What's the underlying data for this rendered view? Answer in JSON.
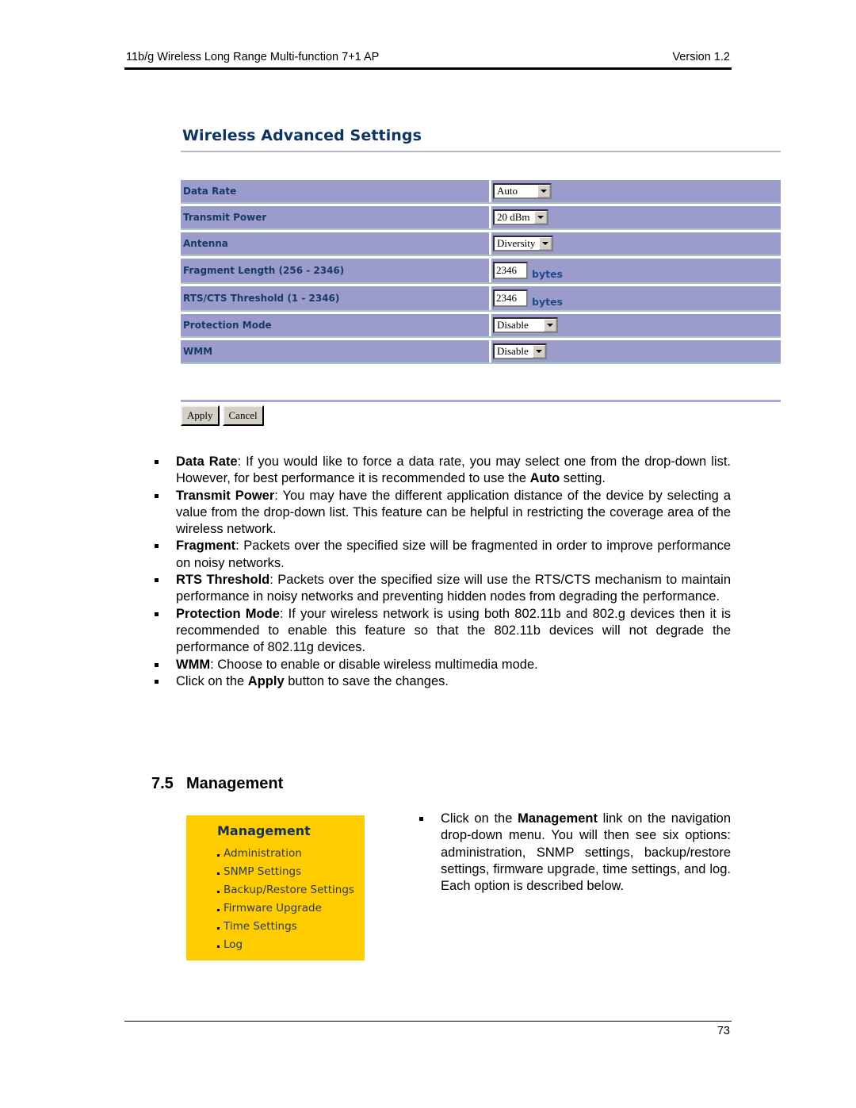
{
  "header": {
    "title": "11b/g Wireless Long Range Multi-function 7+1 AP",
    "version": "Version 1.2"
  },
  "screenshot": {
    "title": "Wireless Advanced Settings",
    "rows": [
      {
        "label": "Data Rate",
        "type": "select",
        "value": "Auto"
      },
      {
        "label": "Transmit Power",
        "type": "select",
        "value": "20 dBm"
      },
      {
        "label": "Antenna",
        "type": "select",
        "value": "Diversity"
      },
      {
        "label": "Fragment Length (256 - 2346)",
        "type": "text",
        "value": "2346",
        "unit": "bytes"
      },
      {
        "label": "RTS/CTS Threshold (1 - 2346)",
        "type": "text",
        "value": "2346",
        "unit": "bytes"
      },
      {
        "label": "Protection Mode",
        "type": "select",
        "value": "Disable"
      },
      {
        "label": "WMM",
        "type": "select",
        "value": "Disable"
      }
    ],
    "apply_label": "Apply",
    "cancel_label": "Cancel"
  },
  "descriptions": [
    {
      "term": "Data Rate",
      "text_before": ": If you would like to force a data rate, you may select one from the drop-down list. However, for best performance it is recommended to use the ",
      "bold_mid": "Auto",
      "text_after": " setting."
    },
    {
      "term": "Transmit Power",
      "text_before": ": You may have the different application distance of the device by selecting a value from the drop-down list. This feature can be helpful in restricting the coverage area of the wireless network.",
      "bold_mid": "",
      "text_after": ""
    },
    {
      "term": "Fragment",
      "text_before": ": Packets over the specified size will be fragmented in order to improve performance on noisy networks.",
      "bold_mid": "",
      "text_after": ""
    },
    {
      "term": "RTS Threshold",
      "text_before": ": Packets over the specified size will use the RTS/CTS mechanism to maintain performance in noisy networks and preventing hidden nodes from degrading the performance.",
      "bold_mid": "",
      "text_after": ""
    },
    {
      "term": "Protection Mode",
      "text_before": ": If your wireless network is using both 802.11b and 802.g devices then it is recommended to enable this feature so that the 802.11b devices will not degrade the performance of 802.11g devices.",
      "bold_mid": "",
      "text_after": ""
    },
    {
      "term": "WMM",
      "text_before": ": Choose to enable or disable wireless multimedia mode.",
      "bold_mid": "",
      "text_after": ""
    },
    {
      "term": "",
      "text_before": "Click on the ",
      "bold_mid": "Apply",
      "text_after": " button to save the changes."
    }
  ],
  "section": {
    "number": "7.5",
    "title": "Management"
  },
  "management_menu": {
    "title": "Management",
    "items": [
      "Administration",
      "SNMP Settings",
      "Backup/Restore Settings",
      "Firmware Upgrade",
      "Time Settings",
      "Log"
    ]
  },
  "management_desc": {
    "before": "Click on the ",
    "bold": "Management",
    "after": " link on the navigation drop-down menu. You will then see six options: administration, SNMP settings, backup/restore settings, firmware upgrade, time settings, and log. Each option is described below."
  },
  "footer": {
    "page_number": "73"
  },
  "colors": {
    "row_bg": "#9c9ccc",
    "title_color": "#0c3463",
    "menu_bg": "#ffcc00"
  }
}
